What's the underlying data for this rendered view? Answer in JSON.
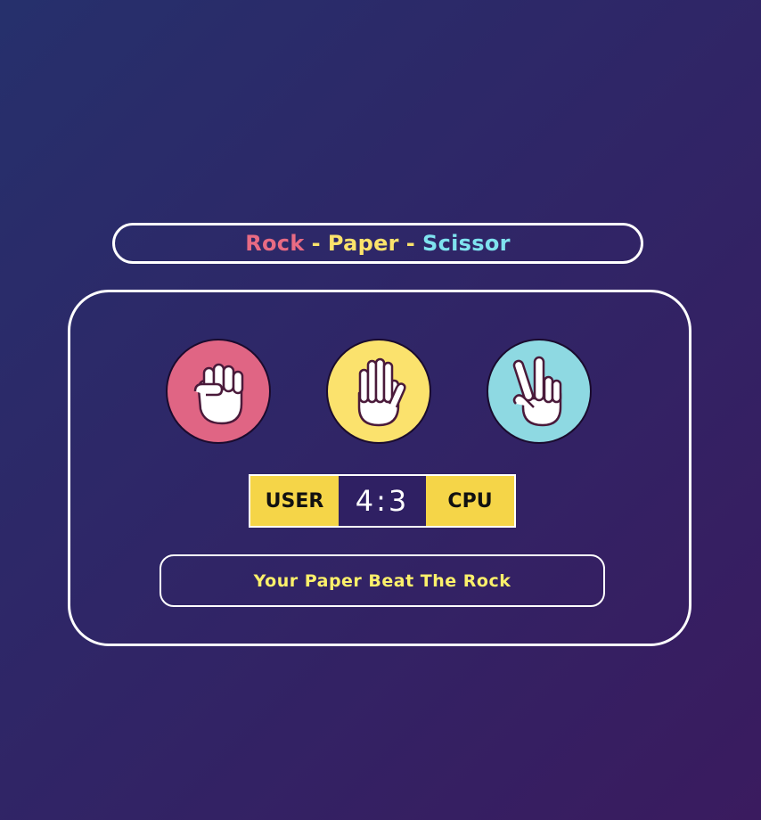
{
  "title": {
    "rock": "Rock",
    "separator": "-",
    "paper": "Paper",
    "scissor": "Scissor"
  },
  "choices": [
    {
      "name": "rock",
      "icon": "fist-icon",
      "color": "#e06584"
    },
    {
      "name": "paper",
      "icon": "open-hand-icon",
      "color": "#fbe26d"
    },
    {
      "name": "scissor",
      "icon": "peace-hand-icon",
      "color": "#8ed9e2"
    }
  ],
  "scoreboard": {
    "user_label": "USER",
    "score": "4:3",
    "cpu_label": "CPU"
  },
  "result": {
    "message": "Your Paper Beat The Rock"
  },
  "colors": {
    "title_rock": "#e86b83",
    "title_paper": "#fbe36b",
    "title_scissor": "#7fe3ef",
    "score_label_bg": "#f5d548",
    "result_text": "#fbf06b"
  }
}
